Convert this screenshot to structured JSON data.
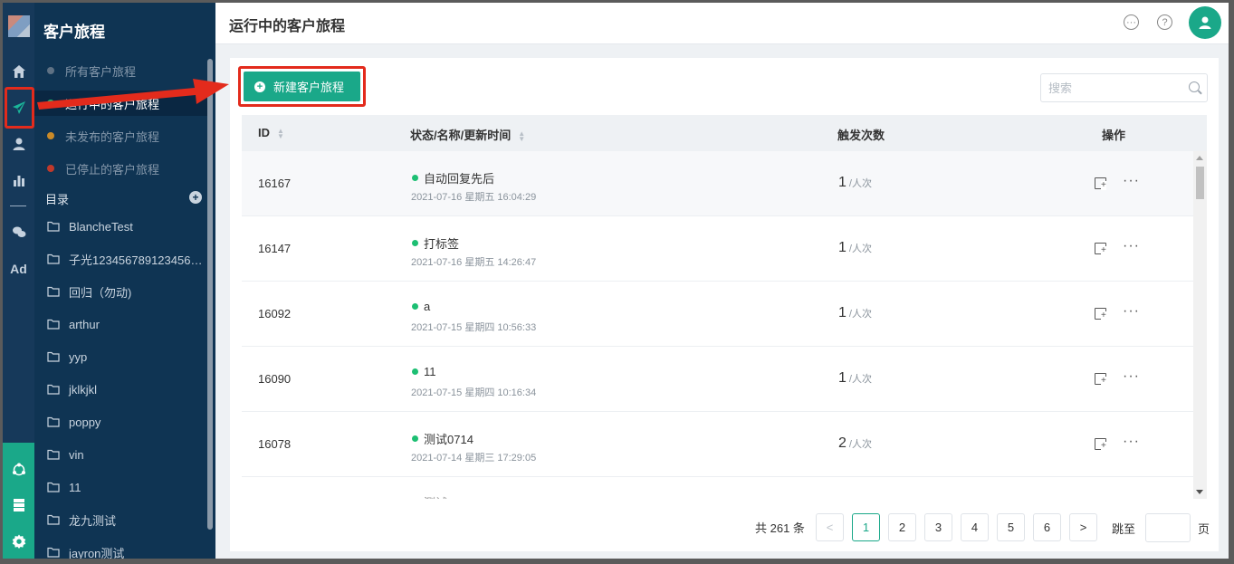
{
  "sidebar": {
    "title": "客户旅程",
    "journeys": [
      {
        "label": "所有客户旅程",
        "color": "#5e7184",
        "active": false
      },
      {
        "label": "运行中的客户旅程",
        "color": "#1dbf73",
        "active": true
      },
      {
        "label": "未发布的客户旅程",
        "color": "#c98a28",
        "active": false
      },
      {
        "label": "已停止的客户旅程",
        "color": "#c0392b",
        "active": false
      }
    ],
    "directory_label": "目录",
    "folders": [
      "BlancheTest",
      "子光123456789123456…",
      "回归（勿动)",
      "arthur",
      "yyp",
      "jklkjkl",
      "poppy",
      "vin",
      "11",
      "龙九测试",
      "jayron测试"
    ]
  },
  "rail": {
    "items": [
      "home-icon",
      "journey-icon",
      "user-icon",
      "chart-icon",
      "wechat-icon",
      "ad-icon"
    ],
    "ad_label": "Ad",
    "bottom_items": [
      "network-icon",
      "server-icon",
      "settings-icon"
    ]
  },
  "header": {
    "title": "运行中的客户旅程",
    "icons": [
      "chat-icon",
      "help-icon",
      "avatar-icon"
    ]
  },
  "toolbar": {
    "new_button_label": "新建客户旅程",
    "search_placeholder": "搜索"
  },
  "table": {
    "columns": {
      "id": "ID",
      "name": "状态/名称/更新时间",
      "count": "触发次数",
      "actions": "操作"
    },
    "rows": [
      {
        "id": "16167",
        "name": "自动回复先后",
        "time": "2021-07-16 星期五 16:04:29",
        "count": "1",
        "unit": "/人次"
      },
      {
        "id": "16147",
        "name": "打标签",
        "time": "2021-07-16 星期五 14:26:47",
        "count": "1",
        "unit": "/人次"
      },
      {
        "id": "16092",
        "name": "a",
        "time": "2021-07-15 星期四 10:56:33",
        "count": "1",
        "unit": "/人次"
      },
      {
        "id": "16090",
        "name": "11",
        "time": "2021-07-15 星期四 10:16:34",
        "count": "1",
        "unit": "/人次"
      },
      {
        "id": "16078",
        "name": "测试0714",
        "time": "2021-07-14 星期三 17:29:05",
        "count": "2",
        "unit": "/人次"
      }
    ],
    "partial_row_name": "测试..."
  },
  "pagination": {
    "total": "共 261 条",
    "pages": [
      "1",
      "2",
      "3",
      "4",
      "5",
      "6"
    ],
    "current": "1",
    "prev": "<",
    "next": ">",
    "jump_label": "跳至",
    "page_suffix": "页"
  },
  "colors": {
    "accent": "#1aa889",
    "sidebar_bg": "#0f3453",
    "annotation": "#e32b1c"
  }
}
